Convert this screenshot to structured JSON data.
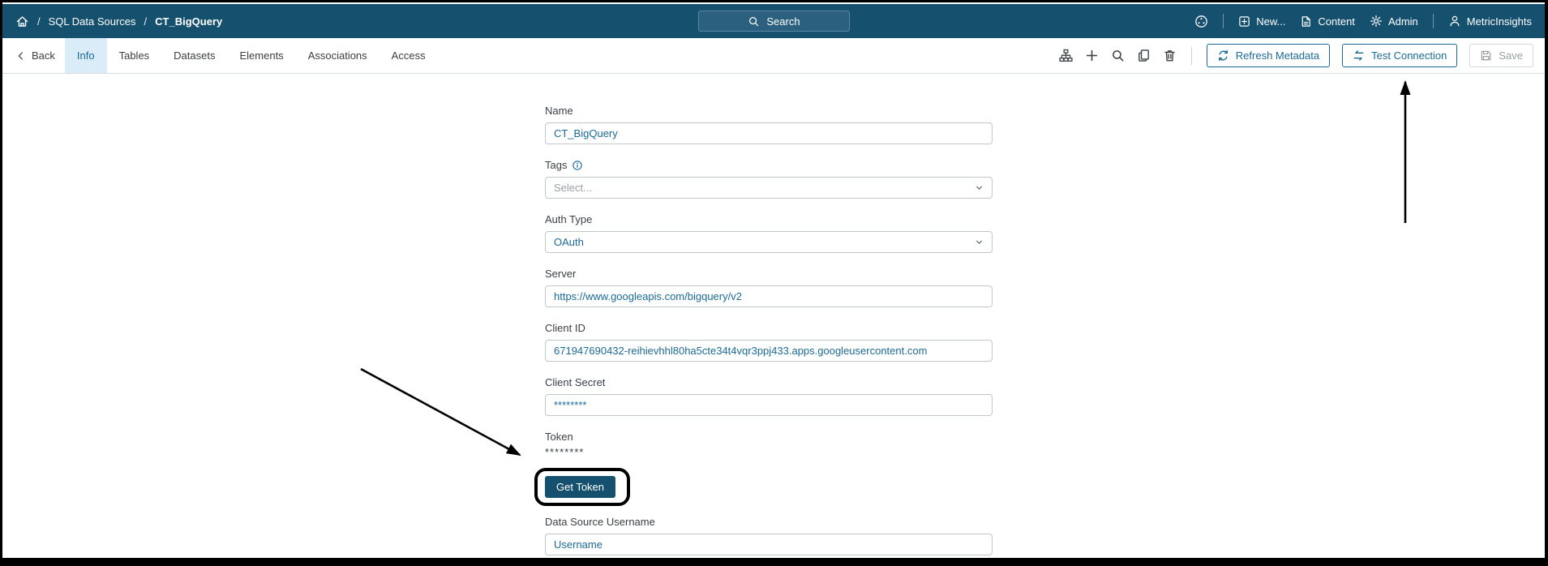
{
  "topbar": {
    "breadcrumb": {
      "separator": "/",
      "section": "SQL Data Sources",
      "page": "CT_BigQuery"
    },
    "search_placeholder": "Search",
    "nav": {
      "new": "New...",
      "content": "Content",
      "admin": "Admin",
      "user": "MetricInsights"
    }
  },
  "toolbar": {
    "back": "Back",
    "tabs": [
      {
        "label": "Info",
        "active": true
      },
      {
        "label": "Tables"
      },
      {
        "label": "Datasets"
      },
      {
        "label": "Elements"
      },
      {
        "label": "Associations"
      },
      {
        "label": "Access"
      }
    ],
    "buttons": {
      "refresh": "Refresh Metadata",
      "test": "Test Connection",
      "save": "Save"
    }
  },
  "form": {
    "name": {
      "label": "Name",
      "value": "CT_BigQuery"
    },
    "tags": {
      "label": "Tags",
      "placeholder": "Select..."
    },
    "auth_type": {
      "label": "Auth Type",
      "value": "OAuth"
    },
    "server": {
      "label": "Server",
      "value": "https://www.googleapis.com/bigquery/v2"
    },
    "client_id": {
      "label": "Client ID",
      "value": "671947690432-reihievhhl80ha5cte34t4vqr3ppj433.apps.googleusercontent.com"
    },
    "client_secret": {
      "label": "Client Secret",
      "value": "********"
    },
    "token": {
      "label": "Token",
      "value": "********",
      "button": "Get Token"
    },
    "username": {
      "label": "Data Source Username",
      "value": "Username"
    }
  },
  "colors": {
    "topbar_bg": "#15506f",
    "accent": "#1b6a96",
    "active_tab_bg": "#d9ecf7",
    "input_text": "#1b6a96",
    "button_bg": "#15506f",
    "disabled_text": "#9aa0a6",
    "annotation": "#000000"
  }
}
